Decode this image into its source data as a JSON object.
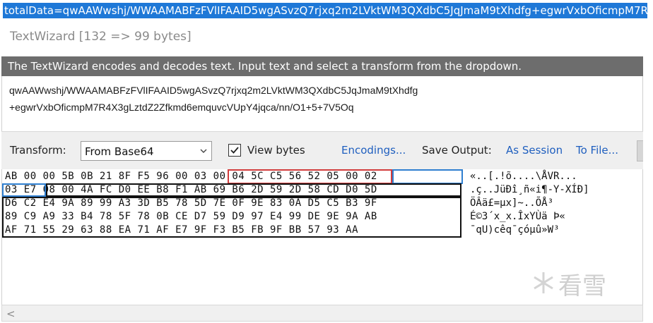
{
  "selected_text": "totalData=qwAAWwshj/WWAAMABFzFVlIFAAID5wgASvzQ7rjxq2m2LVktWM3QXdbC5JqJmaM9tXhdfg+egwrVxbOficmpM7R",
  "window": {
    "title": "TextWizard [132 => 99 bytes]"
  },
  "info_bar": "The TextWizard encodes and decodes text. Input text and select a transform from the dropdown.",
  "input": {
    "line1": "qwAAWwshj/WWAAMABFzFVlIFAAID5wgASvzQ7rjxq2m2LVktWM3QXdbC5JqJmaM9tXhdfg",
    "line2": "+egwrVxbOficmpM7R4X3gLztdZ2Zfkmd6emquvcVUpY4jqca/nn/O1+5+7V5Oq"
  },
  "toolbar": {
    "transform_label": "Transform:",
    "transform_value": "From Base64",
    "view_bytes_label": "View bytes",
    "view_bytes_checked": true,
    "encodings_link": "Encodings...",
    "save_output_label": "Save Output:",
    "as_session_link": "As Session",
    "to_file_link": "To File..."
  },
  "hex": {
    "rows": [
      "AB 00 00 5B 0B 21 8F F5 96 00 03 00 04 5C C5 56 52 05 00 02",
      "03 E7 08 00 4A FC D0 EE B8 F1 AB 69 B6 2D 59 2D 58 CD D0 5D",
      "D6 C2 E4 9A 89 99 A3 3D B5 78 5D 7E 0F 9E 83 0A D5 C5 B3 9F",
      "89 C9 A9 33 B4 78 5F 78 0B CE D7 59 D9 97 E4 99 DE 9E 9A AB",
      "AF 71 55 29 63 88 EA 71 AF E7 9F F3 B5 FB 9F BB 57 93 AA"
    ],
    "ascii": [
      "«..[.!õ....\\ÅVR...",
      ".ç..JüÐî¸ñ«i¶-Y-XÍÐ]",
      "ÖÂä£=µx]~..ÕÅ³",
      "É©3´x_x.ÎxYÙä Þ«",
      "¯qU)cêq¯çóµû»W³"
    ]
  },
  "watermark": "看雪",
  "colors": {
    "selection": "#1e78d7",
    "link": "#1f5fbf",
    "red_box": "#d23c3c",
    "blue_box": "#2f7fd0",
    "black_box": "#111111"
  },
  "icons": {
    "dropdown": "chevron-down-icon",
    "checkbox": "checkmark-icon",
    "scroll_left": "arrow-left-icon",
    "watermark": "snowflake-icon"
  }
}
